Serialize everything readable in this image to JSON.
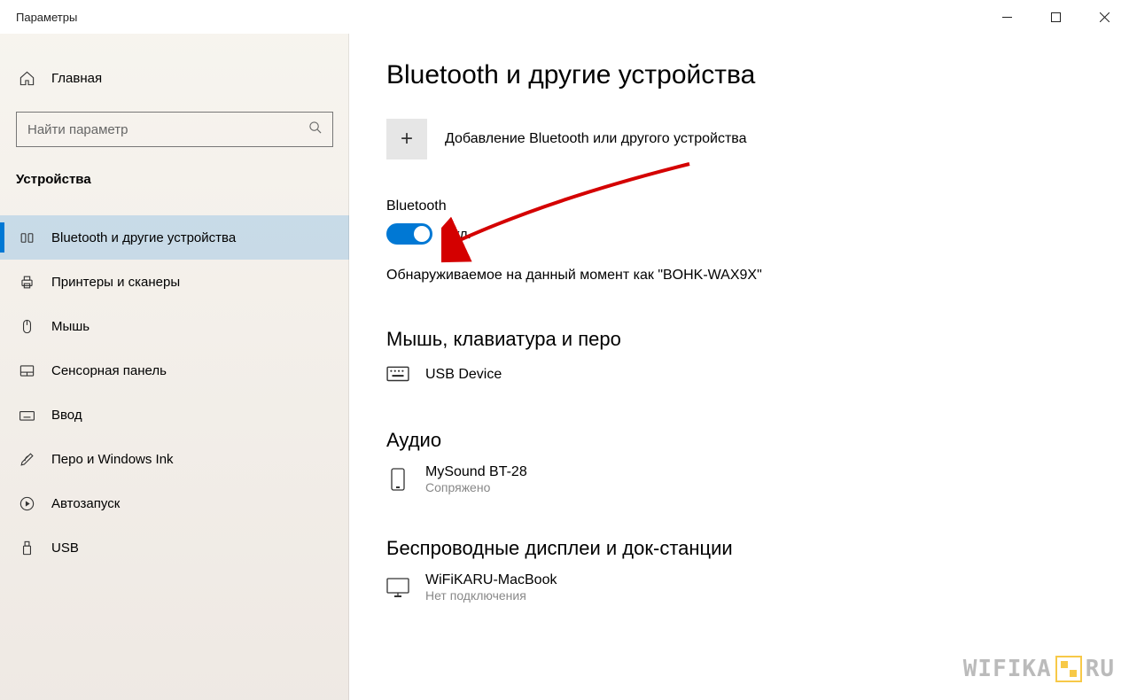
{
  "titlebar": {
    "title": "Параметры"
  },
  "sidebar": {
    "home": "Главная",
    "search_placeholder": "Найти параметр",
    "category": "Устройства",
    "items": [
      {
        "label": "Bluetooth и другие устройства",
        "icon": "bluetooth"
      },
      {
        "label": "Принтеры и сканеры",
        "icon": "printer"
      },
      {
        "label": "Мышь",
        "icon": "mouse"
      },
      {
        "label": "Сенсорная панель",
        "icon": "touchpad"
      },
      {
        "label": "Ввод",
        "icon": "keyboard"
      },
      {
        "label": "Перо и Windows Ink",
        "icon": "pen"
      },
      {
        "label": "Автозапуск",
        "icon": "autoplay"
      },
      {
        "label": "USB",
        "icon": "usb"
      }
    ]
  },
  "main": {
    "page_title": "Bluetooth и другие устройства",
    "add_label": "Добавление Bluetooth или другого устройства",
    "bt_heading": "Bluetooth",
    "toggle_status": "Вкл.",
    "discoverable": "Обнаруживаемое на данный момент как \"BOHK-WAX9X\"",
    "section_mouse": "Мышь, клавиатура и перо",
    "dev_usb": {
      "name": "USB Device"
    },
    "section_audio": "Аудио",
    "dev_audio": {
      "name": "MySound BT-28",
      "status": "Сопряжено"
    },
    "section_wireless": "Беспроводные дисплеи и док-станции",
    "dev_wireless": {
      "name": "WiFiKARU-MacBook",
      "status": "Нет подключения"
    }
  },
  "watermark": {
    "left": "WIFIKA",
    "right": "RU"
  }
}
